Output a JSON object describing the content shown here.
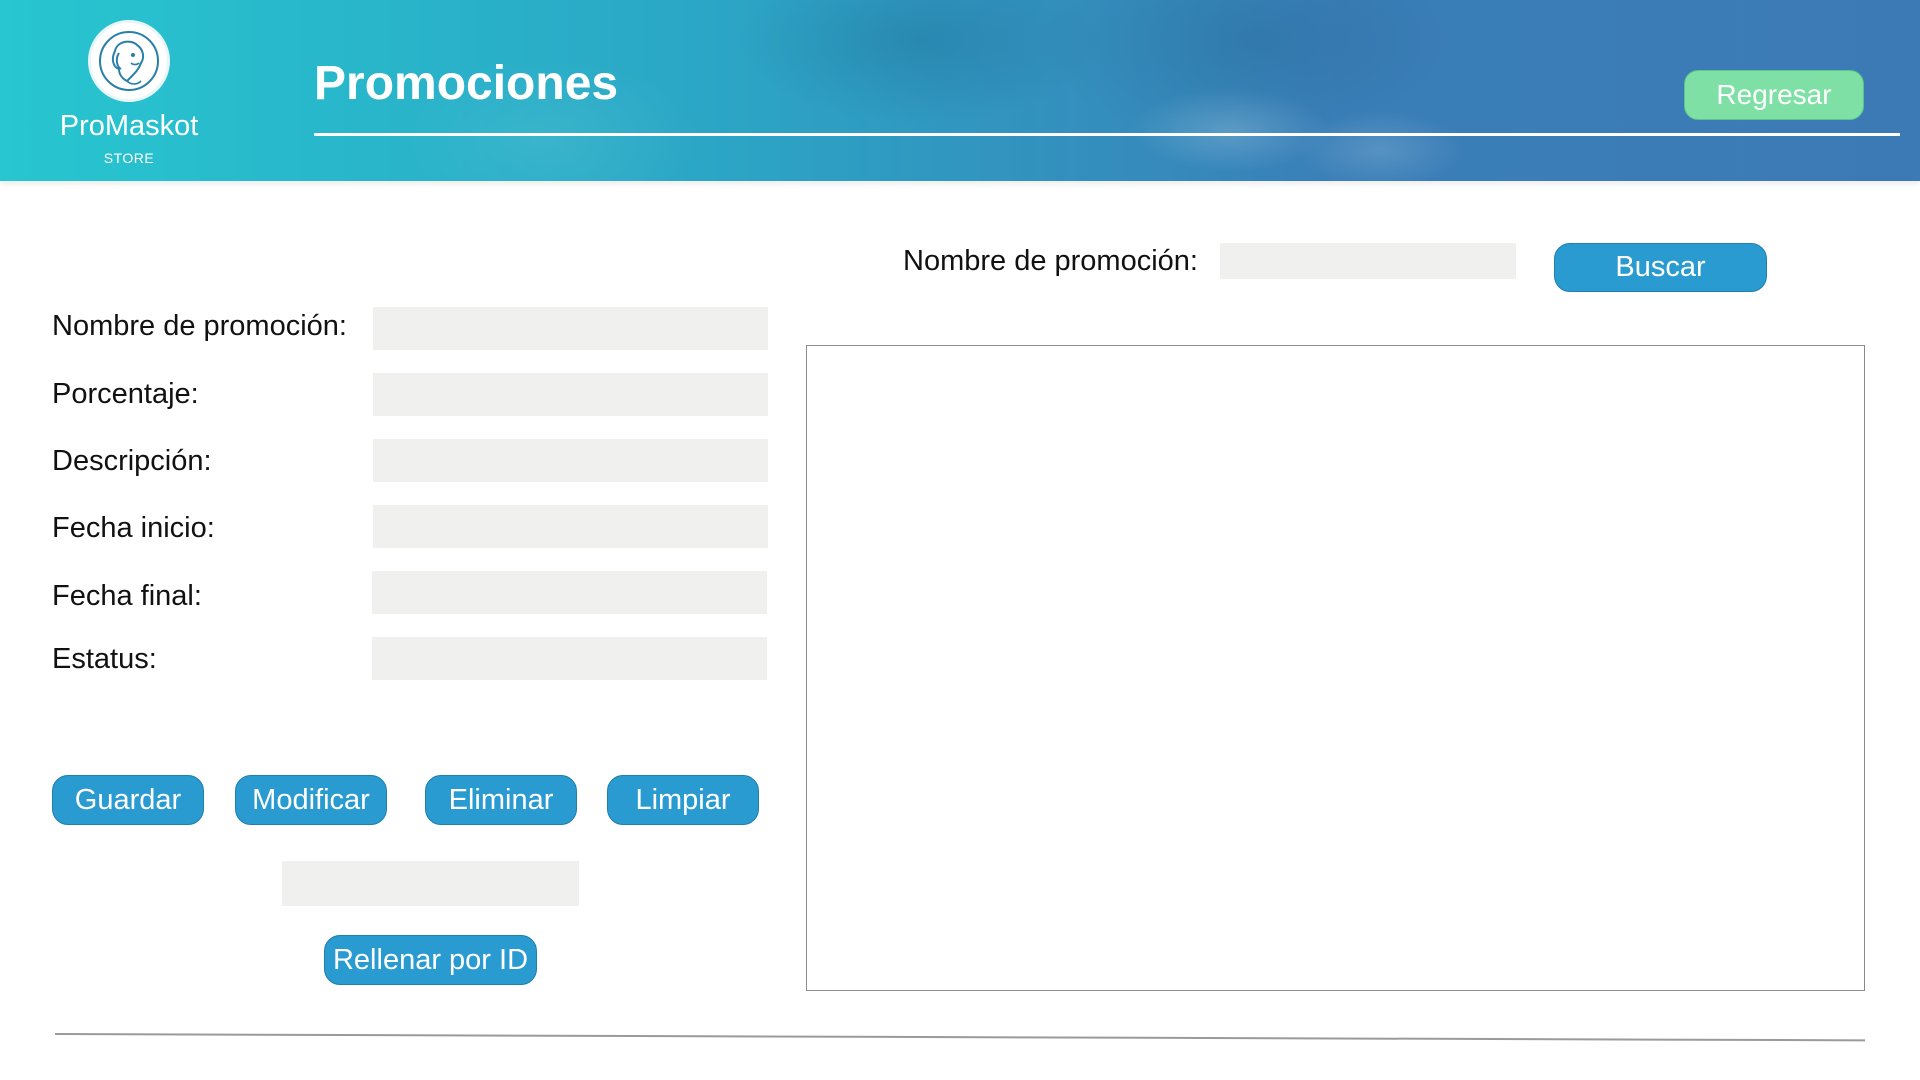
{
  "header": {
    "brand_name": "ProMaskot",
    "brand_sub": "STORE",
    "logo_icon": "dog-head-icon",
    "title": "Promociones",
    "back_label": "Regresar",
    "colors": {
      "banner_start": "#27c6d0",
      "banner_end": "#3c7ab6",
      "back_button": "#7ee0a4"
    }
  },
  "form": {
    "fields": [
      {
        "label": "Nombre de promoción:",
        "value": ""
      },
      {
        "label": "Porcentaje:",
        "value": ""
      },
      {
        "label": "Descripción:",
        "value": ""
      },
      {
        "label": "Fecha inicio:",
        "value": ""
      },
      {
        "label": "Fecha final:",
        "value": ""
      },
      {
        "label": "Estatus:",
        "value": ""
      }
    ],
    "buttons": {
      "save": "Guardar",
      "modify": "Modificar",
      "delete": "Eliminar",
      "clear": "Limpiar"
    },
    "id_input_value": "",
    "fill_by_id": "Rellenar por ID",
    "button_color": "#2a9bd0"
  },
  "search": {
    "label": "Nombre de promoción:",
    "value": "",
    "button": "Buscar"
  },
  "results": {
    "rows": []
  }
}
